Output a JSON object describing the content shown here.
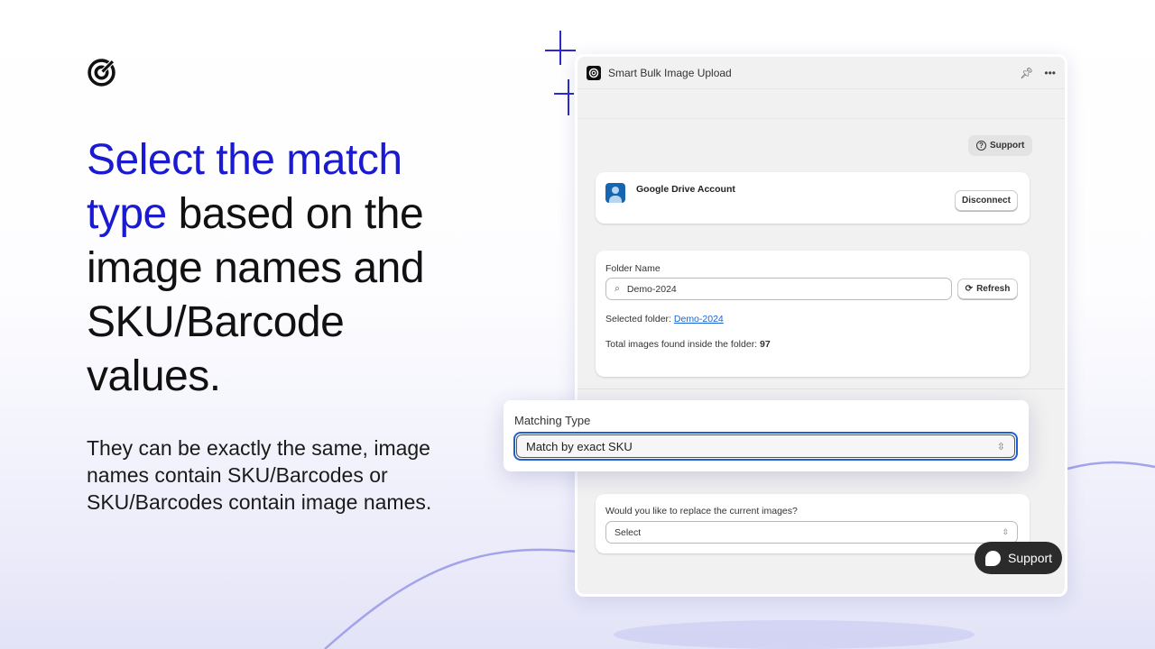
{
  "hero": {
    "headline_highlight": "Select the match type",
    "headline_rest": " based on the image names and SKU/Barcode values.",
    "subtitle": "They can be exactly the same, image names contain SKU/Barcodes or SKU/Barcodes contain image names."
  },
  "window": {
    "title": "Smart Bulk Image Upload",
    "support_label": "Support",
    "account": {
      "title": "Google Drive Account",
      "disconnect_label": "Disconnect"
    },
    "folder": {
      "label": "Folder Name",
      "value": "Demo-2024",
      "refresh_label": "Refresh",
      "selected_prefix": "Selected folder: ",
      "selected_link": "Demo-2024",
      "total_prefix": "Total images found inside the folder: ",
      "total_value": "97"
    },
    "replace": {
      "label": "Would you like to replace the current images?",
      "value": "Select"
    }
  },
  "matching": {
    "label": "Matching Type",
    "value": "Match by exact SKU"
  },
  "fab": {
    "label": "Support"
  },
  "colors": {
    "accent": "#1a1ad0",
    "focus": "#1f5fd6",
    "link": "#1565d8"
  }
}
